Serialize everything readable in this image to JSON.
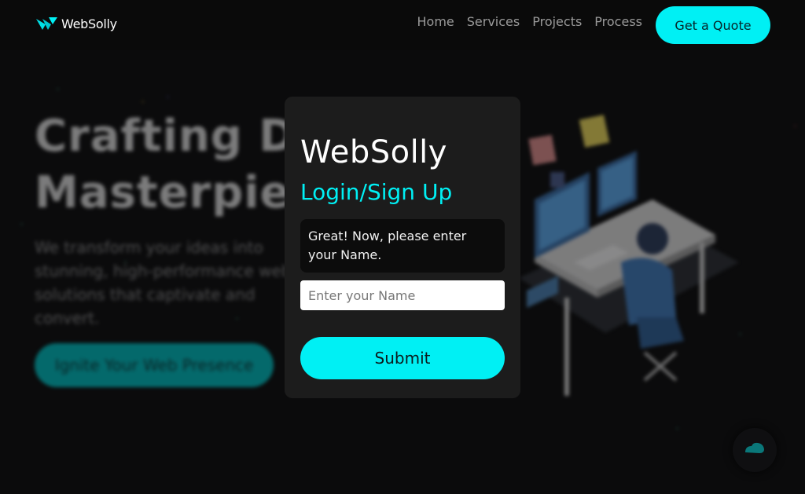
{
  "nav": {
    "logo_text": "WebSolly",
    "links": [
      "Home",
      "Services",
      "Projects",
      "Process"
    ],
    "cta_label": "Get a Quote"
  },
  "hero": {
    "title_line1": "Crafting Digital",
    "title_line2": "Masterpieces",
    "subtitle": "We transform your ideas into stunning, high-performance web solutions that captivate and convert.",
    "cta_label": "Ignite Your Web Presence"
  },
  "modal": {
    "brand": "WebSolly",
    "heading": "Login/Sign Up",
    "prompt": "Great! Now, please enter your Name.",
    "input_placeholder": "Enter your Name",
    "input_value": "",
    "submit_label": "Submit"
  },
  "colors": {
    "accent": "#00f0f4",
    "background": "#0b0b0c",
    "modal_bg": "#1c1c1c"
  },
  "icons": [
    "websolly-logo-icon",
    "chat-icon"
  ]
}
